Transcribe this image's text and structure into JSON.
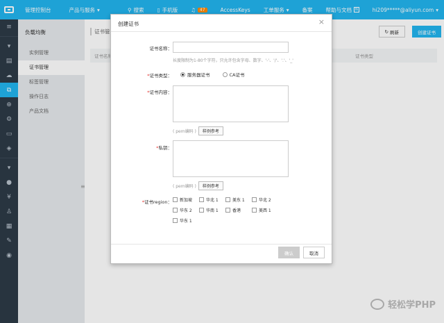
{
  "topbar": {
    "console": "管理控制台",
    "products": "产品与服务",
    "search": "搜索",
    "mobile": "手机版",
    "notif_count": "47",
    "accesskeys": "AccessKeys",
    "tickets": "工单服务",
    "record": "备案",
    "help": "帮助与文档",
    "help_badge": "N",
    "user": "hi209*****@aliyun.com"
  },
  "subnav": {
    "title": "负载均衡",
    "items": [
      "实例管理",
      "证书管理",
      "标签管理",
      "操作日志",
      "产品文档"
    ]
  },
  "main": {
    "breadcrumb": "证书管",
    "refresh": "刷新",
    "create": "创建证书",
    "col1": "证书名称",
    "col2": "证书类型"
  },
  "modal": {
    "title": "创建证书",
    "name_label": "证书名称：",
    "name_hint": "长度限制为1-80个字符，只允许包含字母、数字、'-'、'/'、'.'、'_'",
    "type_label": "证书类型：",
    "type_server": "服务器证书",
    "type_ca": "CA证书",
    "content_label": "证书内容：",
    "content_sub": "( pem编码 )",
    "content_btn": "样例参考",
    "key_label": "私钥：",
    "key_sub": "( pem编码 )",
    "key_btn": "样例参考",
    "region_label": "证书region：",
    "regions": [
      "新加坡",
      "华北 1",
      "美东 1",
      "华北 2",
      "华东 2",
      "华南 1",
      "香港",
      "美西 1",
      "华东 1"
    ],
    "ok": "确认",
    "cancel": "取消"
  },
  "watermark": "轻松学PHP"
}
